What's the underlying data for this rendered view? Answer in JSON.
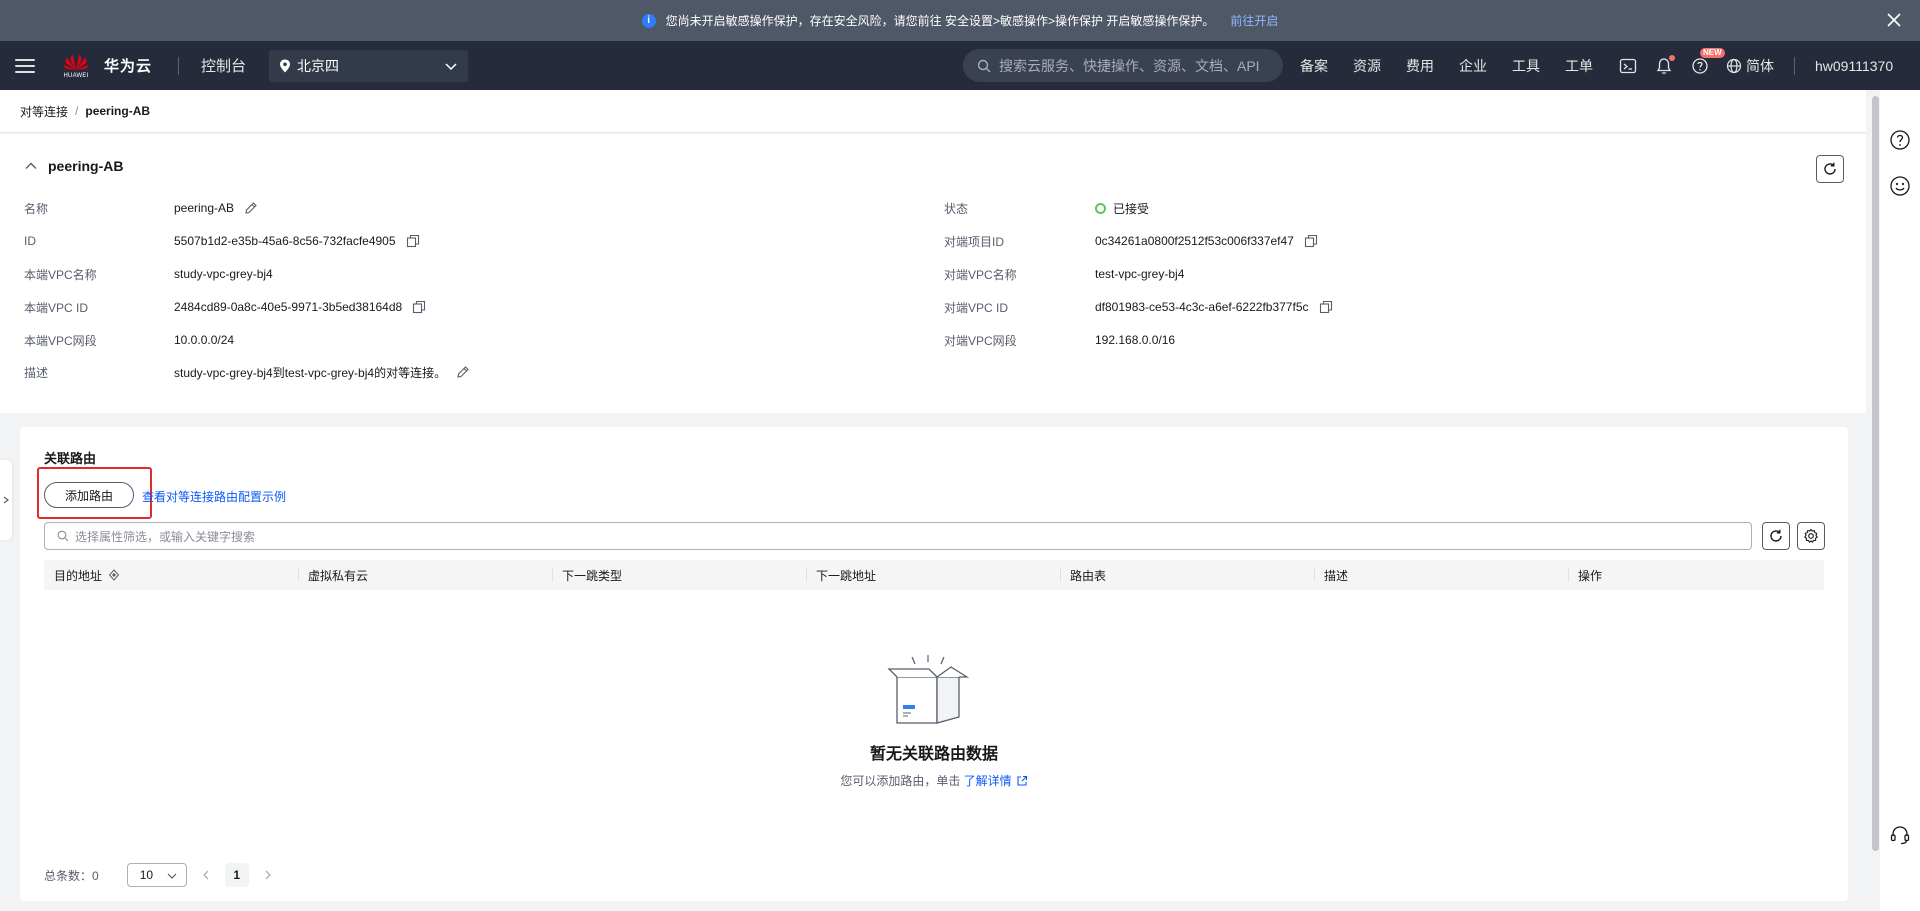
{
  "banner": {
    "message": "您尚未开启敏感操作保护，存在安全风险，请您前往 安全设置>敏感操作>操作保护 开启敏感操作保护。",
    "link": "前往开启",
    "info_glyph": "i"
  },
  "topnav": {
    "logo_text": "HUAWEI",
    "brand": "华为云",
    "console": "控制台",
    "region": "北京四",
    "search_placeholder": "搜索云服务、快捷操作、资源、文档、API",
    "items": [
      "备案",
      "资源",
      "费用",
      "企业",
      "工具",
      "工单"
    ],
    "new_badge": "NEW",
    "language": "简体",
    "user": "hw09111370"
  },
  "breadcrumb": {
    "parent": "对等连接",
    "separator": "/",
    "current": "peering-AB"
  },
  "details": {
    "title": "peering-AB",
    "left": [
      {
        "key": "名称",
        "value": "peering-AB"
      },
      {
        "key": "ID",
        "value": "5507b1d2-e35b-45a6-8c56-732facfe4905"
      },
      {
        "key": "本端VPC名称",
        "value": "study-vpc-grey-bj4"
      },
      {
        "key": "本端VPC ID",
        "value": "2484cd89-0a8c-40e5-9971-3b5ed38164d8"
      },
      {
        "key": "本端VPC网段",
        "value": "10.0.0.0/24"
      },
      {
        "key": "描述",
        "value": "study-vpc-grey-bj4到test-vpc-grey-bj4的对等连接。"
      }
    ],
    "right": [
      {
        "key": "状态",
        "value": "已接受"
      },
      {
        "key": "对端项目ID",
        "value": "0c34261a0800f2512f53c006f337ef47"
      },
      {
        "key": "对端VPC名称",
        "value": "test-vpc-grey-bj4"
      },
      {
        "key": "对端VPC ID",
        "value": "df801983-ce53-4c3c-a6ef-6222fb377f5c"
      },
      {
        "key": "对端VPC网段",
        "value": "192.168.0.0/16"
      }
    ]
  },
  "routes": {
    "title": "关联路由",
    "add_button": "添加路由",
    "example_link": "查看对等连接路由配置示例",
    "filter_placeholder": "选择属性筛选，或输入关键字搜索",
    "columns": [
      "目的地址",
      "虚拟私有云",
      "下一跳类型",
      "下一跳地址",
      "路由表",
      "描述",
      "操作"
    ],
    "empty_title": "暂无关联路由数据",
    "empty_hint": "您可以添加路由，单击",
    "empty_link": "了解详情",
    "total_label": "总条数：",
    "total": "0",
    "page_size": "10",
    "page": "1"
  },
  "colors": {
    "banner_bg": "#4f5867",
    "nav_bg": "#252b3a",
    "link": "#0a59f7",
    "status_ok": "#5ec45e",
    "highlight": "#e02c2c"
  }
}
